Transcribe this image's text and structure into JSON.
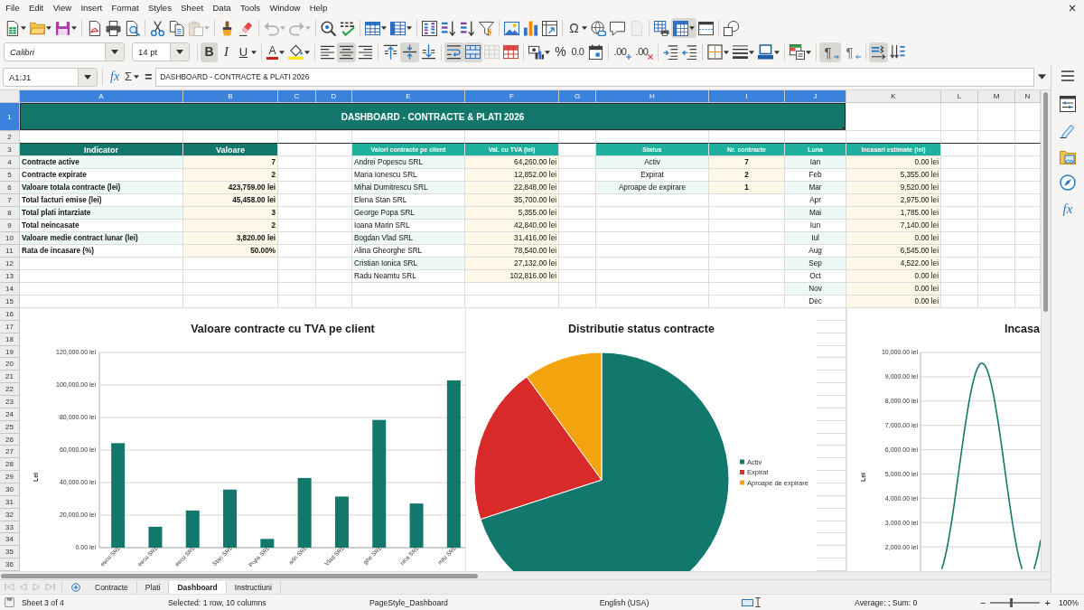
{
  "menu_bar": {
    "items": [
      "File",
      "Edit",
      "View",
      "Insert",
      "Format",
      "Styles",
      "Sheet",
      "Data",
      "Tools",
      "Window",
      "Help"
    ],
    "close_button": "×"
  },
  "standard_toolbar": [
    [
      {
        "kind": "new",
        "dropdown": true,
        "pressed": false,
        "disabled": false
      },
      {
        "kind": "open",
        "dropdown": true,
        "pressed": false,
        "disabled": false
      },
      {
        "kind": "save",
        "dropdown": true,
        "pressed": false,
        "disabled": false
      }
    ],
    [
      {
        "kind": "pdf",
        "dropdown": false,
        "pressed": false,
        "disabled": false
      },
      {
        "kind": "print",
        "dropdown": false,
        "pressed": false,
        "disabled": false
      },
      {
        "kind": "preview",
        "dropdown": false,
        "pressed": false,
        "disabled": false
      }
    ],
    [
      {
        "kind": "cut",
        "dropdown": false,
        "pressed": false,
        "disabled": false
      },
      {
        "kind": "copy",
        "dropdown": false,
        "pressed": false,
        "disabled": false
      },
      {
        "kind": "paste",
        "dropdown": true,
        "pressed": false,
        "disabled": true
      }
    ],
    [
      {
        "kind": "clone",
        "dropdown": false,
        "pressed": false,
        "disabled": false
      },
      {
        "kind": "clear",
        "dropdown": false,
        "pressed": false,
        "disabled": false
      }
    ],
    [
      {
        "kind": "undo",
        "dropdown": true,
        "pressed": false,
        "disabled": true
      },
      {
        "kind": "redo",
        "dropdown": true,
        "pressed": false,
        "disabled": true
      }
    ],
    [
      {
        "kind": "find",
        "dropdown": false,
        "pressed": false,
        "disabled": false
      },
      {
        "kind": "spelling",
        "dropdown": false,
        "pressed": false,
        "disabled": false
      }
    ],
    [
      {
        "kind": "rows",
        "dropdown": true,
        "pressed": false,
        "disabled": false
      },
      {
        "kind": "columns",
        "dropdown": true,
        "pressed": false,
        "disabled": false
      }
    ],
    [
      {
        "kind": "sort",
        "dropdown": false,
        "pressed": false,
        "disabled": false
      },
      {
        "kind": "ascending",
        "dropdown": false,
        "pressed": false,
        "disabled": false
      },
      {
        "kind": "descending",
        "dropdown": false,
        "pressed": false,
        "disabled": false
      },
      {
        "kind": "filter",
        "dropdown": false,
        "pressed": false,
        "disabled": false
      }
    ],
    [
      {
        "kind": "image",
        "dropdown": false,
        "pressed": false,
        "disabled": false
      },
      {
        "kind": "chart",
        "dropdown": false,
        "pressed": false,
        "disabled": false
      },
      {
        "kind": "pivot",
        "dropdown": false,
        "pressed": false,
        "disabled": false
      }
    ],
    [
      {
        "kind": "special",
        "glyph": "Ω",
        "dropdown": true,
        "pressed": false,
        "disabled": false
      },
      {
        "kind": "hyperlink",
        "dropdown": false,
        "pressed": false,
        "disabled": false
      },
      {
        "kind": "comment",
        "dropdown": false,
        "pressed": false,
        "disabled": false
      },
      {
        "kind": "headers",
        "dropdown": false,
        "pressed": false,
        "disabled": true
      }
    ],
    [
      {
        "kind": "printarea",
        "dropdown": false,
        "pressed": false,
        "disabled": false
      },
      {
        "kind": "freeze",
        "dropdown": true,
        "pressed": true,
        "disabled": false
      },
      {
        "kind": "split",
        "dropdown": false,
        "pressed": false,
        "disabled": false
      }
    ],
    [
      {
        "kind": "draw",
        "dropdown": false,
        "pressed": false,
        "disabled": false
      }
    ]
  ],
  "formatting_toolbar": {
    "font_name": "Calibri",
    "font_size": "14 pt",
    "groups": [
      [
        {
          "kind": "bold",
          "glyph": "B",
          "dropdown": false,
          "pressed": true,
          "disabled": false
        },
        {
          "kind": "italic",
          "glyph": "I",
          "dropdown": false,
          "pressed": false,
          "disabled": false
        },
        {
          "kind": "underline",
          "glyph": "U",
          "dropdown": true,
          "pressed": false,
          "disabled": false
        }
      ],
      [
        {
          "kind": "fontcolor",
          "glyph": "A",
          "dropdown": true,
          "pressed": false,
          "disabled": false
        },
        {
          "kind": "highlight",
          "dropdown": true,
          "pressed": false,
          "disabled": false
        }
      ],
      [
        {
          "kind": "left",
          "dropdown": false,
          "pressed": false,
          "disabled": false
        },
        {
          "kind": "center",
          "dropdown": false,
          "pressed": true,
          "disabled": false
        },
        {
          "kind": "right",
          "dropdown": false,
          "pressed": false,
          "disabled": false
        }
      ],
      [
        {
          "kind": "top",
          "dropdown": false,
          "pressed": false,
          "disabled": false
        },
        {
          "kind": "middle",
          "dropdown": false,
          "pressed": true,
          "disabled": false
        },
        {
          "kind": "bottom",
          "dropdown": false,
          "pressed": false,
          "disabled": false
        }
      ],
      [
        {
          "kind": "wrap",
          "dropdown": false,
          "pressed": true,
          "disabled": false
        },
        {
          "kind": "mergecenter",
          "dropdown": false,
          "pressed": true,
          "disabled": false
        },
        {
          "kind": "merge",
          "dropdown": false,
          "pressed": false,
          "disabled": true
        },
        {
          "kind": "unmerge",
          "dropdown": false,
          "pressed": false,
          "disabled": false
        }
      ],
      [
        {
          "kind": "currency",
          "dropdown": true,
          "pressed": false,
          "disabled": false
        },
        {
          "kind": "percent",
          "glyph": "%",
          "dropdown": false,
          "pressed": false,
          "disabled": false
        },
        {
          "kind": "number",
          "glyph": "0.0",
          "dropdown": false,
          "pressed": false,
          "disabled": false
        },
        {
          "kind": "date",
          "dropdown": false,
          "pressed": false,
          "disabled": false
        }
      ],
      [
        {
          "kind": "adddecimal",
          "glyph": ".00",
          "dropdown": false,
          "pressed": false,
          "disabled": false
        },
        {
          "kind": "deldecimal",
          "glyph": ".00",
          "dropdown": false,
          "pressed": false,
          "disabled": false
        }
      ],
      [
        {
          "kind": "indent",
          "dropdown": false,
          "pressed": false,
          "disabled": false
        },
        {
          "kind": "outdent",
          "dropdown": false,
          "pressed": false,
          "disabled": false
        }
      ],
      [
        {
          "kind": "borders",
          "dropdown": true,
          "pressed": false,
          "disabled": false
        },
        {
          "kind": "borderstyle",
          "dropdown": true,
          "pressed": false,
          "disabled": false
        },
        {
          "kind": "bordercolor",
          "dropdown": true,
          "pressed": false,
          "disabled": false
        }
      ],
      [
        {
          "kind": "conditional",
          "dropdown": true,
          "pressed": false,
          "disabled": false
        }
      ],
      [
        {
          "kind": "ltr",
          "glyph": "¶",
          "dropdown": false,
          "pressed": true,
          "disabled": false
        },
        {
          "kind": "rtl",
          "glyph": "¶",
          "dropdown": false,
          "pressed": false,
          "disabled": false
        }
      ],
      [
        {
          "kind": "textltr",
          "dropdown": false,
          "pressed": true,
          "disabled": false
        },
        {
          "kind": "textttb",
          "dropdown": false,
          "pressed": false,
          "disabled": false
        }
      ]
    ]
  },
  "formula_bar": {
    "name_box": "A1:J1",
    "function_wizard": "fx",
    "sum": "Σ",
    "formula": "=",
    "content": "DASHBOARD - CONTRACTE & PLATI 2026"
  },
  "sidebar": {
    "functions": "fx"
  },
  "sheet": {
    "columns": [
      {
        "label": "A",
        "selected": true
      },
      {
        "label": "B",
        "selected": true
      },
      {
        "label": "C",
        "selected": true
      },
      {
        "label": "D",
        "selected": true
      },
      {
        "label": "E",
        "selected": true
      },
      {
        "label": "F",
        "selected": true
      },
      {
        "label": "G",
        "selected": true
      },
      {
        "label": "H",
        "selected": true
      },
      {
        "label": "I",
        "selected": true
      },
      {
        "label": "J",
        "selected": true
      },
      {
        "label": "K",
        "selected": false
      },
      {
        "label": "L",
        "selected": false
      },
      {
        "label": "M",
        "selected": false
      },
      {
        "label": "N",
        "selected": false
      }
    ],
    "rows": [
      {
        "label": "1",
        "selected": true
      },
      {
        "label": "2",
        "selected": false
      },
      {
        "label": "3",
        "selected": false
      },
      {
        "label": "4",
        "selected": false
      },
      {
        "label": "5",
        "selected": false
      },
      {
        "label": "6",
        "selected": false
      },
      {
        "label": "7",
        "selected": false
      },
      {
        "label": "8",
        "selected": false
      },
      {
        "label": "9",
        "selected": false
      },
      {
        "label": "10",
        "selected": false
      },
      {
        "label": "11",
        "selected": false
      },
      {
        "label": "12",
        "selected": false
      },
      {
        "label": "13",
        "selected": false
      },
      {
        "label": "14",
        "selected": false
      },
      {
        "label": "15",
        "selected": false
      },
      {
        "label": "16",
        "selected": false
      },
      {
        "label": "17",
        "selected": false
      },
      {
        "label": "18",
        "selected": false
      },
      {
        "label": "19",
        "selected": false
      },
      {
        "label": "20",
        "selected": false
      },
      {
        "label": "21",
        "selected": false
      },
      {
        "label": "22",
        "selected": false
      },
      {
        "label": "23",
        "selected": false
      },
      {
        "label": "24",
        "selected": false
      },
      {
        "label": "25",
        "selected": false
      },
      {
        "label": "26",
        "selected": false
      },
      {
        "label": "27",
        "selected": false
      },
      {
        "label": "28",
        "selected": false
      },
      {
        "label": "29",
        "selected": false
      },
      {
        "label": "30",
        "selected": false
      },
      {
        "label": "31",
        "selected": false
      },
      {
        "label": "32",
        "selected": false
      },
      {
        "label": "33",
        "selected": false
      },
      {
        "label": "34",
        "selected": false
      },
      {
        "label": "35",
        "selected": false
      },
      {
        "label": "36",
        "selected": false
      }
    ],
    "title": "DASHBOARD - CONTRACTE & PLATI 2026",
    "tables": [
      {
        "headers": [
          "Indicator",
          "Valoare"
        ],
        "rows": [
          [
            "Contracte active",
            "7"
          ],
          [
            "Contracte expirate",
            "2"
          ],
          [
            "Valoare totala contracte (lei)",
            "423,759.00 lei"
          ],
          [
            "Total facturi emise (lei)",
            "45,458.00 lei"
          ],
          [
            "Total plati intarziate",
            "3"
          ],
          [
            "Total neincasate",
            "2"
          ],
          [
            "Valoare medie contract lunar (lei)",
            "3,820.00 lei"
          ],
          [
            "Rata de incasare (%)",
            "50.00%"
          ]
        ]
      },
      {
        "headers": [
          "Valori contracte pe client",
          "Val. cu TVA (lei)"
        ],
        "rows": [
          [
            "Andrei Popescu SRL",
            "64,260.00 lei"
          ],
          [
            "Maria Ionescu SRL",
            "12,852.00 lei"
          ],
          [
            "Mihai Dumitrescu SRL",
            "22,848.00 lei"
          ],
          [
            "Elena Stan SRL",
            "35,700.00 lei"
          ],
          [
            "George Popa SRL",
            "5,355.00 lei"
          ],
          [
            "Ioana Marin SRL",
            "42,840.00 lei"
          ],
          [
            "Bogdan Vlad SRL",
            "31,416.00 lei"
          ],
          [
            "Alina Gheorghe SRL",
            "78,540.00 lei"
          ],
          [
            "Cristian Ionica SRL",
            "27,132.00 lei"
          ],
          [
            "Radu Neamtu SRL",
            "102,816.00 lei"
          ]
        ]
      },
      {
        "headers": [
          "Status",
          "Nr. contracte"
        ],
        "rows": [
          [
            "Activ",
            "7"
          ],
          [
            "Expirat",
            "2"
          ],
          [
            "Aproape de expirare",
            "1"
          ]
        ]
      },
      {
        "headers": [
          "Luna",
          "Incasari estimate (lei)"
        ],
        "rows": [
          [
            "Ian",
            "0.00 lei"
          ],
          [
            "Feb",
            "5,355.00 lei"
          ],
          [
            "Mar",
            "9,520.00 lei"
          ],
          [
            "Apr",
            "2,975.00 lei"
          ],
          [
            "Mai",
            "1,785.00 lei"
          ],
          [
            "Iun",
            "7,140.00 lei"
          ],
          [
            "Iul",
            "0.00 lei"
          ],
          [
            "Aug",
            "6,545.00 lei"
          ],
          [
            "Sep",
            "4,522.00 lei"
          ],
          [
            "Oct",
            "0.00 lei"
          ],
          [
            "Nov",
            "0.00 lei"
          ],
          [
            "Dec",
            "0.00 lei"
          ]
        ]
      }
    ],
    "charts": [
      {
        "chart_data": {
          "type": "bar",
          "title": "Valoare contracte cu TVA pe client",
          "ylabel": "Lei",
          "categories": [
            "escu SRL",
            "escu SRL",
            "escu SRL",
            "Stan SRL",
            "Popa SRL",
            "arin SRL",
            "Vlad SRL",
            "ghe SRL",
            "nica SRL",
            "mtu SRL"
          ],
          "values": [
            64260,
            12852,
            22848,
            35700,
            5355,
            42840,
            31416,
            78540,
            27132,
            102816
          ],
          "ylim": [
            0,
            120000
          ],
          "yticks": [
            {
              "value": 0,
              "label": "0.00 lei"
            },
            {
              "value": 20000,
              "label": "20,000.00 lei"
            },
            {
              "value": 40000,
              "label": "40,000.00 lei"
            },
            {
              "value": 60000,
              "label": "60,000.00 lei"
            },
            {
              "value": 80000,
              "label": "80,000.00 lei"
            },
            {
              "value": 100000,
              "label": "100,000.00 lei"
            },
            {
              "value": 120000,
              "label": "120,000.00 lei"
            }
          ],
          "grid": true
        }
      },
      {
        "chart_data": {
          "type": "pie",
          "title": "Distributie status contracte",
          "categories": [
            "Activ",
            "Expirat",
            "Aproape de expirare"
          ],
          "values": [
            70,
            20,
            10
          ],
          "legend": "right"
        },
        "slices": [
          {
            "color": "#12786c"
          },
          {
            "color": "#d92a2a"
          },
          {
            "color": "#f4a40e"
          }
        ]
      },
      {
        "kind": "line",
        "title": "Incasa",
        "ylabel": "Lei",
        "y_tick_labels": [
          "10,000.00 lei",
          "9,000.00 lei",
          "8,000.00 lei",
          "7,000.00 lei",
          "6,000.00 lei",
          "5,000.00 lei",
          "4,000.00 lei",
          "3,000.00 lei",
          "2,000.00 lei"
        ]
      }
    ]
  },
  "sheet_tabs": [
    {
      "label": "Contracte",
      "selected": false
    },
    {
      "label": "Plati",
      "selected": false
    },
    {
      "label": "Dashboard",
      "selected": true
    },
    {
      "label": "Instructiuni",
      "selected": false
    }
  ],
  "status_bar": {
    "sheet_position": "Sheet 3 of 4",
    "selection": "Selected: 1 row, 10 columns",
    "page_style": "PageStyle_Dashboard",
    "language": "English (USA)",
    "statistics": "Average: ; Sum: 0",
    "zoom": {
      "minus": "−",
      "plus": "+",
      "level": 0.42,
      "value": "100%"
    }
  }
}
